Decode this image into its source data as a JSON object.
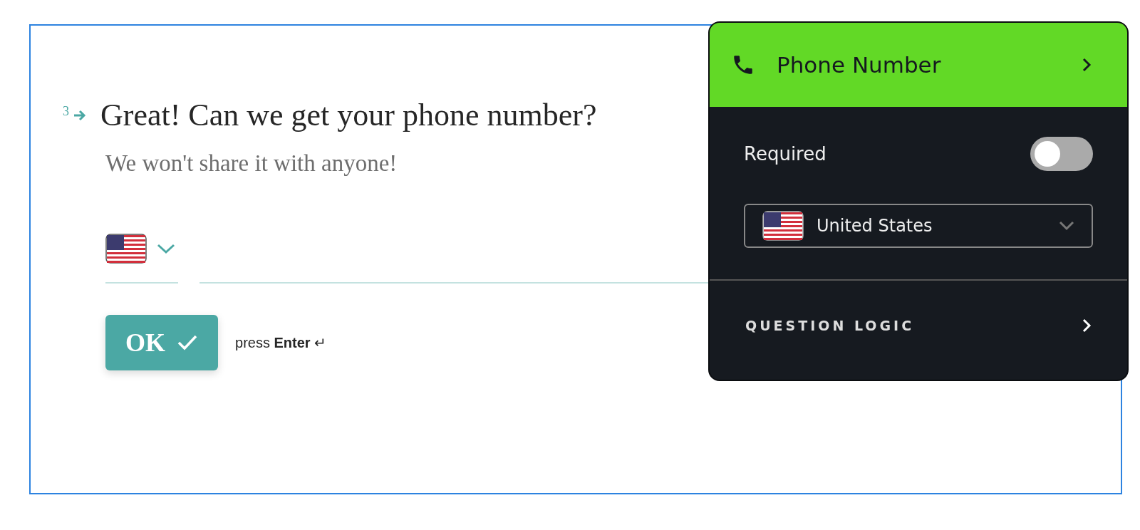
{
  "question": {
    "number": "3",
    "title": "Great! Can we get your phone number?",
    "subtitle": "We won't share it with anyone!"
  },
  "ok_button": {
    "label": "OK"
  },
  "hint": "press **Enter** ↵",
  "settings_panel": {
    "title": "Phone Number",
    "required": {
      "label": "Required",
      "on": false
    },
    "country": {
      "value": "United States"
    },
    "question_logic": {
      "label": "QUESTION LOGIC"
    }
  }
}
